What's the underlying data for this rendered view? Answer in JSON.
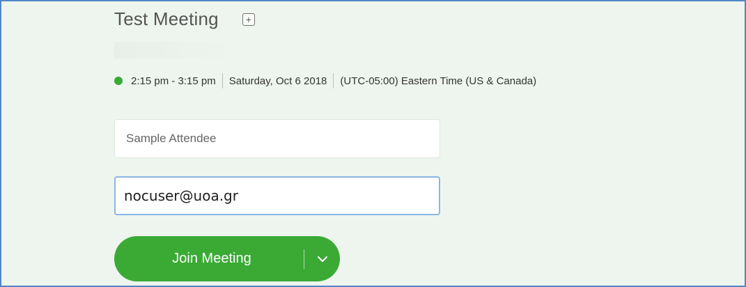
{
  "meeting": {
    "title": "Test Meeting",
    "add_icon": "plus-square-icon",
    "status_color": "#3aaa35",
    "time_range": "2:15 pm - 3:15 pm",
    "date": "Saturday, Oct 6 2018",
    "timezone": "(UTC-05:00) Eastern Time (US & Canada)"
  },
  "form": {
    "name_placeholder": "Sample Attendee",
    "email_value": "nocuser@uoa.gr"
  },
  "join_button": {
    "label": "Join Meeting",
    "dropdown_icon": "chevron-down-icon",
    "color": "#3aaa35"
  },
  "colors": {
    "background": "#eef5ee",
    "frame_border": "#4f86c6",
    "focus_border": "#8ab6e6"
  }
}
